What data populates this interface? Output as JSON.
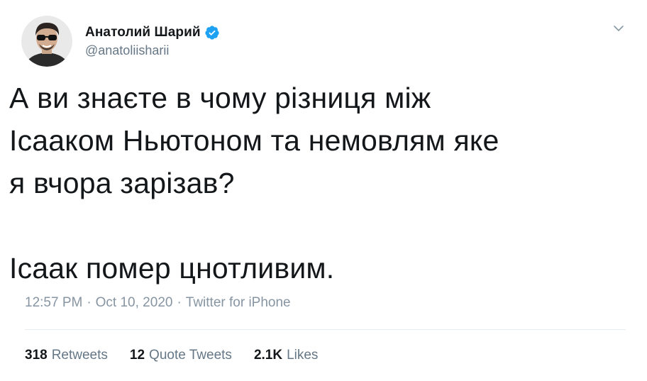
{
  "author": {
    "display_name": "Анатолий Шарий",
    "handle": "@anatoliisharii",
    "verified": true,
    "avatar_icon": "avatar-photo"
  },
  "tweet": {
    "lines_paragraph_1": [
      "А ви знаєте в чому різниця між",
      "Ісааком Ньютоном та немовлям яке",
      "я вчора зарізав?"
    ],
    "paragraph_2": "Ісаак помер цнотливим."
  },
  "meta": {
    "time": "12:57 PM",
    "date": "Oct 10, 2020",
    "source": "Twitter for iPhone",
    "separator": "·"
  },
  "stats": {
    "retweets": {
      "count": "318",
      "label": "Retweets"
    },
    "quotes": {
      "count": "12",
      "label": "Quote Tweets"
    },
    "likes": {
      "count": "2.1K",
      "label": "Likes"
    }
  },
  "colors": {
    "verified_badge": "#1da1f2",
    "muted_text": "#657786",
    "primary_text": "#14171a",
    "divider": "#e6ecf0"
  },
  "icons": {
    "verified": "verified-badge-icon",
    "menu": "chevron-down-icon"
  }
}
